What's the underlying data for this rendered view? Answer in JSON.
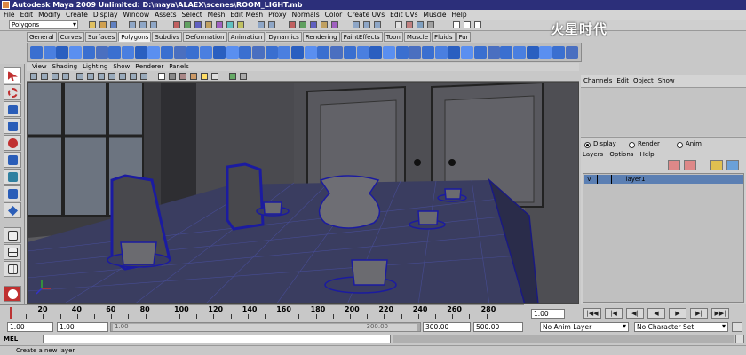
{
  "window": {
    "title": "Autodesk Maya 2009 Unlimited: D:\\maya\\ALAEX\\scenes\\ROOM_LIGHT.mb"
  },
  "menubar": [
    "File",
    "Edit",
    "Modify",
    "Create",
    "Display",
    "Window",
    "Assets",
    "Select",
    "Mesh",
    "Edit Mesh",
    "Proxy",
    "Normals",
    "Color",
    "Create UVs",
    "Edit UVs",
    "Muscle",
    "Help"
  ],
  "statusline": {
    "menuset": "Polygons"
  },
  "shelf_tabs": [
    "General",
    "Curves",
    "Surfaces",
    "Polygons",
    "Subdivs",
    "Deformation",
    "Animation",
    "Dynamics",
    "Rendering",
    "PaintEffects",
    "Toon",
    "Muscle",
    "Fluids",
    "Fur"
  ],
  "active_shelf_tab": "Polygons",
  "viewport_menu": [
    "View",
    "Shading",
    "Lighting",
    "Show",
    "Renderer",
    "Panels"
  ],
  "channel_box": {
    "menu": [
      "Channels",
      "Edit",
      "Object",
      "Show"
    ]
  },
  "layer_editor": {
    "modes": [
      "Display",
      "Render",
      "Anim"
    ],
    "selected_mode": "Display",
    "menu": [
      "Layers",
      "Options",
      "Help"
    ],
    "layers": [
      {
        "visible": "V",
        "name": "layer1"
      }
    ]
  },
  "time_slider": {
    "ticks": [
      "20",
      "40",
      "60",
      "80",
      "100",
      "120",
      "140",
      "160",
      "180",
      "200",
      "220",
      "240",
      "260",
      "280"
    ],
    "current_frame": "1.00"
  },
  "playback_buttons": [
    "|◀◀",
    "|◀",
    "◀|",
    "◀",
    "▶",
    "▶|",
    "▶▶|"
  ],
  "range": {
    "start_time": "1.00",
    "playback_start": "1.00",
    "slider_start": "1.00",
    "slider_end": "300.00",
    "playback_end": "300.00",
    "end_time": "500.00",
    "anim_layer": "No Anim Layer",
    "character_set": "No Character Set"
  },
  "command_line": {
    "label": "MEL"
  },
  "help_line": "Create a new layer",
  "watermark": "火星时代"
}
